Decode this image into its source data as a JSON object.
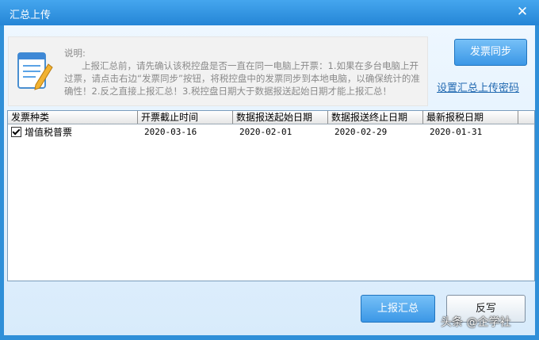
{
  "window": {
    "title": "汇总上传",
    "close_symbol": "✕"
  },
  "notice": {
    "label": "说明:",
    "body": "上报汇总前，请先确认该税控盘是否一直在同一电脑上开票：1.如果在多台电脑上开过票，请点击右边“发票同步”按钮，将税控盘中的发票同步到本地电脑，以确保统计的准确性！2.反之直接上报汇总！3.税控盘日期大于数据报送起始日期才能上报汇总！"
  },
  "actions": {
    "sync_label": "发票同步",
    "set_password_link": "设置汇总上传密码",
    "submit_label": "上报汇总",
    "cancel_label": "反写"
  },
  "table": {
    "columns": [
      "发票种类",
      "开票截止时间",
      "数据报送起始日期",
      "数据报送终止日期",
      "最新报税日期"
    ],
    "rows": [
      {
        "checked": true,
        "category": "增值税普票",
        "deadline": "2020-03-16",
        "report_start": "2020-02-01",
        "report_end": "2020-02-29",
        "latest_tax_date": "2020-01-31"
      }
    ]
  },
  "watermark": "头条 @企学社"
}
